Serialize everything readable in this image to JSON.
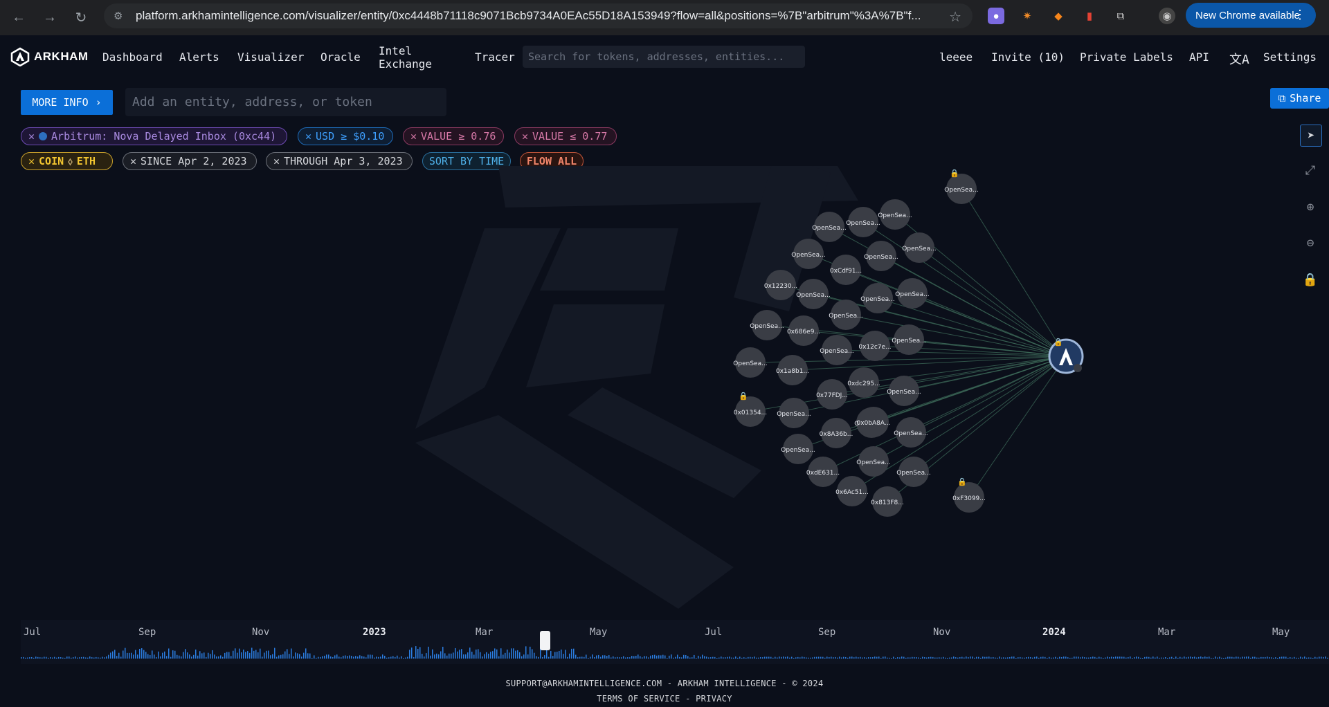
{
  "browser": {
    "url": "platform.arkhamintelligence.com/visualizer/entity/0xc4448b71118c9071Bcb9734A0EAc55D18A153949?flow=all&positions=%7B\"arbitrum\"%3A%7B\"f...",
    "new_chrome_label": "New Chrome available"
  },
  "header": {
    "logo_text": "ARKHAM",
    "nav": [
      "Dashboard",
      "Alerts",
      "Visualizer",
      "Oracle",
      "Intel Exchange",
      "Tracer"
    ],
    "search_placeholder": "Search for tokens, addresses, entities...",
    "right": {
      "user": "leeee",
      "invite": "Invite (10)",
      "private_labels": "Private Labels",
      "api": "API",
      "settings": "Settings"
    }
  },
  "toolbar": {
    "more_info": "MORE INFO",
    "entity_placeholder": "Add an entity, address, or token",
    "share": "Share"
  },
  "filters": [
    {
      "label": "Arbitrum: Nova Delayed Inbox (0xc44)",
      "style": "purple"
    },
    {
      "label": "USD ≥ $0.10",
      "style": "blue"
    },
    {
      "label": "VALUE ≥ 0.76",
      "style": "pink"
    },
    {
      "label": "VALUE ≤ 0.77",
      "style": "pink"
    },
    {
      "label": "COIN",
      "token": "ETH",
      "style": "yellow"
    },
    {
      "label": "SINCE Apr 2, 2023",
      "style": "gray"
    },
    {
      "label": "THROUGH Apr 3, 2023",
      "style": "gray"
    },
    {
      "label": "SORT BY TIME",
      "style": "sky"
    },
    {
      "label": "FLOW ALL",
      "style": "orange"
    }
  ],
  "graph": {
    "center_node": "Arbitrum: Nova Delayed Inbox",
    "nodes": [
      "OpenSea...",
      "OpenSea...",
      "OpenSea...",
      "OpenSea...",
      "OpenSea...",
      "OpenSea...",
      "0xCdf91...",
      "OpenSea...",
      "OpenSea...",
      "0x12230...",
      "OpenSea...",
      "OpenSea...",
      "OpenSea...",
      "OpenSea...",
      "0x686e9...",
      "OpenSea...",
      "0x12c7e...",
      "OpenSea...",
      "OpenSea...",
      "0x1a8b1...",
      "0xdc295...",
      "OpenSea...",
      "0x77FDJ...",
      "OpenSea...",
      "0x01354...",
      "OpenSea...",
      "0x8A36b...",
      "0x0bA8A...",
      "OpenSea...",
      "OpenSea...",
      "OpenSea...",
      "0xdE631...",
      "OpenSea...",
      "0x6Ac51...",
      "0x813F8...",
      "0xF3099..."
    ],
    "colors": {
      "edge": "#3d6b5a",
      "node": "#3a3d45",
      "accent": "#0b6fd8"
    }
  },
  "timeline": {
    "labels": [
      {
        "text": "Jul",
        "year": false
      },
      {
        "text": "Sep",
        "year": false
      },
      {
        "text": "Nov",
        "year": false
      },
      {
        "text": "2023",
        "year": true
      },
      {
        "text": "Mar",
        "year": false
      },
      {
        "text": "May",
        "year": false
      },
      {
        "text": "Jul",
        "year": false
      },
      {
        "text": "Sep",
        "year": false
      },
      {
        "text": "Nov",
        "year": false
      },
      {
        "text": "2024",
        "year": true
      },
      {
        "text": "Mar",
        "year": false
      },
      {
        "text": "May",
        "year": false
      }
    ]
  },
  "footer": {
    "line1": "SUPPORT@ARKHAMINTELLIGENCE.COM - ARKHAM INTELLIGENCE - © 2024",
    "line2": "TERMS OF SERVICE - PRIVACY"
  }
}
